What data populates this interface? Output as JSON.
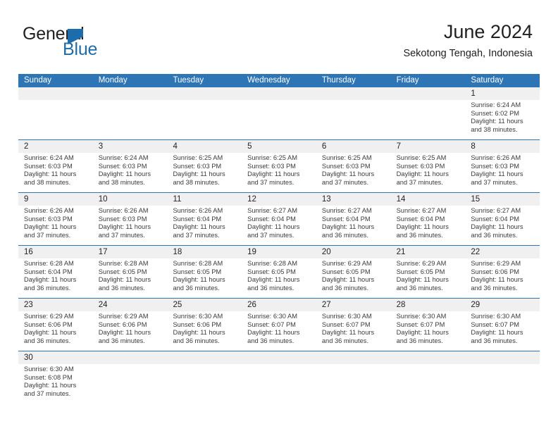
{
  "brand": {
    "name_top": "General",
    "name_bottom": "Blue",
    "triangle_color": "#1d6cab",
    "top_color": "#231f20"
  },
  "header": {
    "title": "June 2024",
    "subtitle": "Sekotong Tengah, Indonesia"
  },
  "colors": {
    "header_blue": "#2e75b6",
    "daynum_band": "#f0f0f0",
    "text": "#231f20",
    "info_text": "#3b3b3b"
  },
  "labels": {
    "sunrise": "Sunrise:",
    "sunset": "Sunset:",
    "daylight": "Daylight:"
  },
  "days_of_week": [
    "Sunday",
    "Monday",
    "Tuesday",
    "Wednesday",
    "Thursday",
    "Friday",
    "Saturday"
  ],
  "weeks": [
    [
      {
        "empty": true
      },
      {
        "empty": true
      },
      {
        "empty": true
      },
      {
        "empty": true
      },
      {
        "empty": true
      },
      {
        "empty": true
      },
      {
        "day": "1",
        "sunrise": "Sunrise: 6:24 AM",
        "sunset": "Sunset: 6:02 PM",
        "daylight1": "Daylight: 11 hours",
        "daylight2": "and 38 minutes."
      }
    ],
    [
      {
        "day": "2",
        "sunrise": "Sunrise: 6:24 AM",
        "sunset": "Sunset: 6:03 PM",
        "daylight1": "Daylight: 11 hours",
        "daylight2": "and 38 minutes."
      },
      {
        "day": "3",
        "sunrise": "Sunrise: 6:24 AM",
        "sunset": "Sunset: 6:03 PM",
        "daylight1": "Daylight: 11 hours",
        "daylight2": "and 38 minutes."
      },
      {
        "day": "4",
        "sunrise": "Sunrise: 6:25 AM",
        "sunset": "Sunset: 6:03 PM",
        "daylight1": "Daylight: 11 hours",
        "daylight2": "and 38 minutes."
      },
      {
        "day": "5",
        "sunrise": "Sunrise: 6:25 AM",
        "sunset": "Sunset: 6:03 PM",
        "daylight1": "Daylight: 11 hours",
        "daylight2": "and 37 minutes."
      },
      {
        "day": "6",
        "sunrise": "Sunrise: 6:25 AM",
        "sunset": "Sunset: 6:03 PM",
        "daylight1": "Daylight: 11 hours",
        "daylight2": "and 37 minutes."
      },
      {
        "day": "7",
        "sunrise": "Sunrise: 6:25 AM",
        "sunset": "Sunset: 6:03 PM",
        "daylight1": "Daylight: 11 hours",
        "daylight2": "and 37 minutes."
      },
      {
        "day": "8",
        "sunrise": "Sunrise: 6:26 AM",
        "sunset": "Sunset: 6:03 PM",
        "daylight1": "Daylight: 11 hours",
        "daylight2": "and 37 minutes."
      }
    ],
    [
      {
        "day": "9",
        "sunrise": "Sunrise: 6:26 AM",
        "sunset": "Sunset: 6:03 PM",
        "daylight1": "Daylight: 11 hours",
        "daylight2": "and 37 minutes."
      },
      {
        "day": "10",
        "sunrise": "Sunrise: 6:26 AM",
        "sunset": "Sunset: 6:03 PM",
        "daylight1": "Daylight: 11 hours",
        "daylight2": "and 37 minutes."
      },
      {
        "day": "11",
        "sunrise": "Sunrise: 6:26 AM",
        "sunset": "Sunset: 6:04 PM",
        "daylight1": "Daylight: 11 hours",
        "daylight2": "and 37 minutes."
      },
      {
        "day": "12",
        "sunrise": "Sunrise: 6:27 AM",
        "sunset": "Sunset: 6:04 PM",
        "daylight1": "Daylight: 11 hours",
        "daylight2": "and 37 minutes."
      },
      {
        "day": "13",
        "sunrise": "Sunrise: 6:27 AM",
        "sunset": "Sunset: 6:04 PM",
        "daylight1": "Daylight: 11 hours",
        "daylight2": "and 36 minutes."
      },
      {
        "day": "14",
        "sunrise": "Sunrise: 6:27 AM",
        "sunset": "Sunset: 6:04 PM",
        "daylight1": "Daylight: 11 hours",
        "daylight2": "and 36 minutes."
      },
      {
        "day": "15",
        "sunrise": "Sunrise: 6:27 AM",
        "sunset": "Sunset: 6:04 PM",
        "daylight1": "Daylight: 11 hours",
        "daylight2": "and 36 minutes."
      }
    ],
    [
      {
        "day": "16",
        "sunrise": "Sunrise: 6:28 AM",
        "sunset": "Sunset: 6:04 PM",
        "daylight1": "Daylight: 11 hours",
        "daylight2": "and 36 minutes."
      },
      {
        "day": "17",
        "sunrise": "Sunrise: 6:28 AM",
        "sunset": "Sunset: 6:05 PM",
        "daylight1": "Daylight: 11 hours",
        "daylight2": "and 36 minutes."
      },
      {
        "day": "18",
        "sunrise": "Sunrise: 6:28 AM",
        "sunset": "Sunset: 6:05 PM",
        "daylight1": "Daylight: 11 hours",
        "daylight2": "and 36 minutes."
      },
      {
        "day": "19",
        "sunrise": "Sunrise: 6:28 AM",
        "sunset": "Sunset: 6:05 PM",
        "daylight1": "Daylight: 11 hours",
        "daylight2": "and 36 minutes."
      },
      {
        "day": "20",
        "sunrise": "Sunrise: 6:29 AM",
        "sunset": "Sunset: 6:05 PM",
        "daylight1": "Daylight: 11 hours",
        "daylight2": "and 36 minutes."
      },
      {
        "day": "21",
        "sunrise": "Sunrise: 6:29 AM",
        "sunset": "Sunset: 6:05 PM",
        "daylight1": "Daylight: 11 hours",
        "daylight2": "and 36 minutes."
      },
      {
        "day": "22",
        "sunrise": "Sunrise: 6:29 AM",
        "sunset": "Sunset: 6:06 PM",
        "daylight1": "Daylight: 11 hours",
        "daylight2": "and 36 minutes."
      }
    ],
    [
      {
        "day": "23",
        "sunrise": "Sunrise: 6:29 AM",
        "sunset": "Sunset: 6:06 PM",
        "daylight1": "Daylight: 11 hours",
        "daylight2": "and 36 minutes."
      },
      {
        "day": "24",
        "sunrise": "Sunrise: 6:29 AM",
        "sunset": "Sunset: 6:06 PM",
        "daylight1": "Daylight: 11 hours",
        "daylight2": "and 36 minutes."
      },
      {
        "day": "25",
        "sunrise": "Sunrise: 6:30 AM",
        "sunset": "Sunset: 6:06 PM",
        "daylight1": "Daylight: 11 hours",
        "daylight2": "and 36 minutes."
      },
      {
        "day": "26",
        "sunrise": "Sunrise: 6:30 AM",
        "sunset": "Sunset: 6:07 PM",
        "daylight1": "Daylight: 11 hours",
        "daylight2": "and 36 minutes."
      },
      {
        "day": "27",
        "sunrise": "Sunrise: 6:30 AM",
        "sunset": "Sunset: 6:07 PM",
        "daylight1": "Daylight: 11 hours",
        "daylight2": "and 36 minutes."
      },
      {
        "day": "28",
        "sunrise": "Sunrise: 6:30 AM",
        "sunset": "Sunset: 6:07 PM",
        "daylight1": "Daylight: 11 hours",
        "daylight2": "and 36 minutes."
      },
      {
        "day": "29",
        "sunrise": "Sunrise: 6:30 AM",
        "sunset": "Sunset: 6:07 PM",
        "daylight1": "Daylight: 11 hours",
        "daylight2": "and 36 minutes."
      }
    ],
    [
      {
        "day": "30",
        "sunrise": "Sunrise: 6:30 AM",
        "sunset": "Sunset: 6:08 PM",
        "daylight1": "Daylight: 11 hours",
        "daylight2": "and 37 minutes."
      },
      {
        "empty": true
      },
      {
        "empty": true
      },
      {
        "empty": true
      },
      {
        "empty": true
      },
      {
        "empty": true
      },
      {
        "empty": true
      }
    ]
  ]
}
